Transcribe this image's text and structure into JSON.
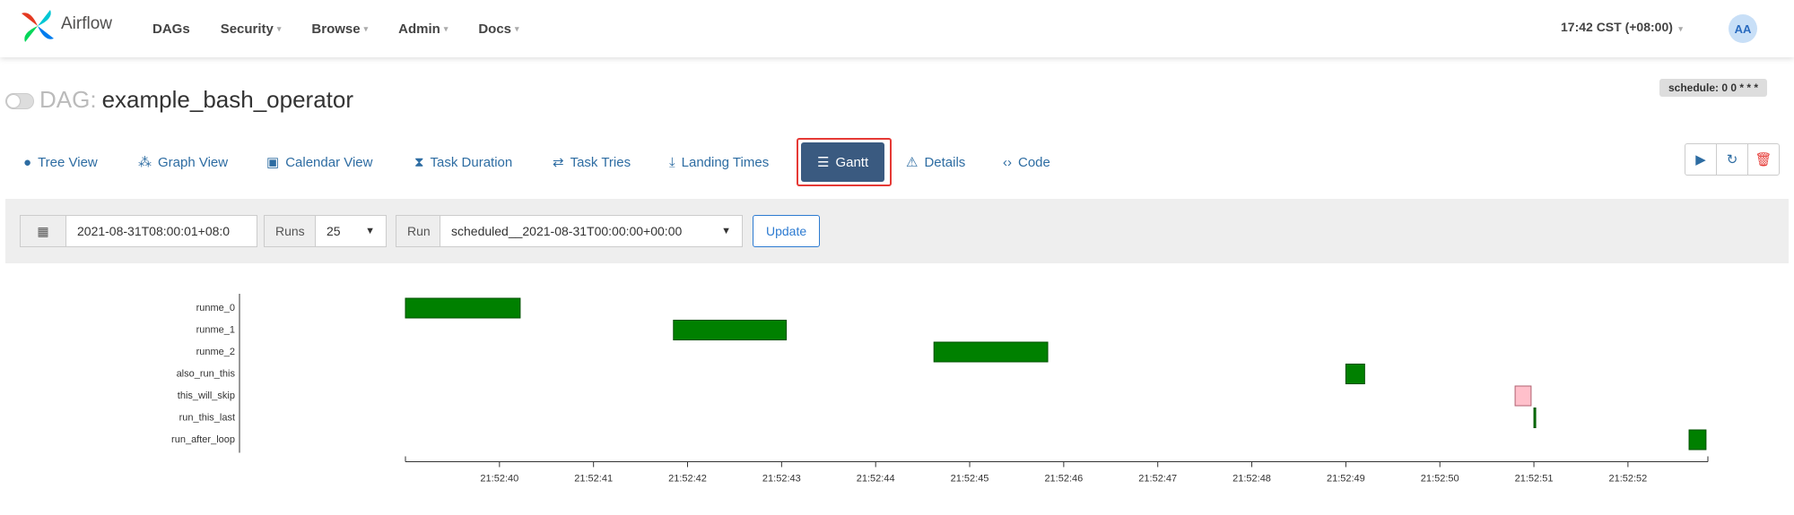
{
  "nav": {
    "brand": "Airflow",
    "items": [
      "DAGs",
      "Security",
      "Browse",
      "Admin",
      "Docs"
    ],
    "time": "17:42 CST (+08:00)",
    "avatar": "AA"
  },
  "dag": {
    "prefix": "DAG:",
    "name": "example_bash_operator",
    "schedule": "schedule: 0 0 * * *"
  },
  "tabs": [
    {
      "label": "Tree View",
      "icon": "tree-icon"
    },
    {
      "label": "Graph View",
      "icon": "graph-icon"
    },
    {
      "label": "Calendar View",
      "icon": "calendar-icon"
    },
    {
      "label": "Task Duration",
      "icon": "hourglass-icon"
    },
    {
      "label": "Task Tries",
      "icon": "retry-icon"
    },
    {
      "label": "Landing Times",
      "icon": "landing-icon"
    },
    {
      "label": "Gantt",
      "icon": "gantt-icon",
      "active": true
    },
    {
      "label": "Details",
      "icon": "warning-icon"
    },
    {
      "label": "Code",
      "icon": "code-icon"
    }
  ],
  "filter": {
    "date": "2021-08-31T08:00:01+08:0",
    "runs_label": "Runs",
    "runs_value": "25",
    "run_label": "Run",
    "run_value": "scheduled__2021-08-31T00:00:00+00:00",
    "update_label": "Update"
  },
  "colors": {
    "success": "#008000",
    "skipped": "#ffc0cb",
    "accent": "#2d6ca2",
    "active_tab": "#3a5a80",
    "highlight": "#e53935"
  },
  "chart_data": {
    "type": "gantt",
    "tasks": [
      "runme_0",
      "runme_1",
      "runme_2",
      "also_run_this",
      "this_will_skip",
      "run_this_last",
      "run_after_loop"
    ],
    "x_ticks": [
      "21:52:40",
      "21:52:41",
      "21:52:42",
      "21:52:43",
      "21:52:44",
      "21:52:45",
      "21:52:46",
      "21:52:47",
      "21:52:48",
      "21:52:49",
      "21:52:50",
      "21:52:51",
      "21:52:52"
    ],
    "x_range": [
      "21:52:39.00",
      "21:52:52.85"
    ],
    "bars": [
      {
        "task": "runme_0",
        "start": "21:52:39.00",
        "end": "21:52:40.22",
        "state": "success"
      },
      {
        "task": "runme_1",
        "start": "21:52:41.85",
        "end": "21:52:43.05",
        "state": "success"
      },
      {
        "task": "runme_2",
        "start": "21:52:44.62",
        "end": "21:52:45.83",
        "state": "success"
      },
      {
        "task": "also_run_this",
        "start": "21:52:49.00",
        "end": "21:52:49.20",
        "state": "success"
      },
      {
        "task": "this_will_skip",
        "start": "21:52:50.80",
        "end": "21:52:50.97",
        "state": "skipped"
      },
      {
        "task": "run_this_last",
        "start": "21:52:51.00",
        "end": "21:52:51.01",
        "state": "success"
      },
      {
        "task": "run_after_loop",
        "start": "21:52:52.65",
        "end": "21:52:52.83",
        "state": "success"
      }
    ]
  }
}
